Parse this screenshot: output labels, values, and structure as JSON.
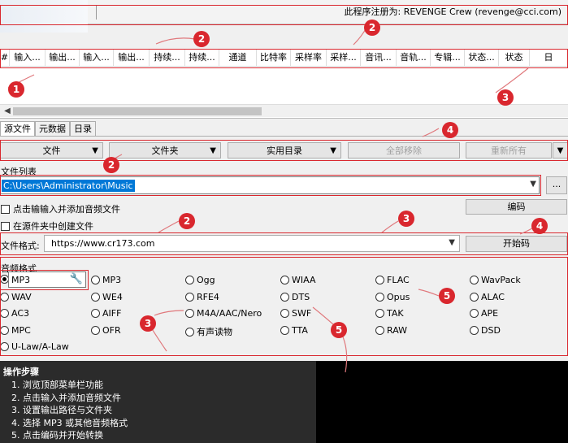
{
  "header": {
    "registered_to": "此程序注册为: REVENGE Crew (revenge@cci.com)"
  },
  "table": {
    "columns": [
      "#",
      "输入...",
      "输出...",
      "输入...",
      "输出...",
      "持续...",
      "持续...",
      "通道",
      "比特率",
      "采样率",
      "采样...",
      "音讯...",
      "音轨...",
      "专辑...",
      "状态...",
      "状态",
      "日"
    ]
  },
  "tabs": [
    "源文件",
    "元数据",
    "日录"
  ],
  "buttons": {
    "file": "文件",
    "folder": "文件夹",
    "utility": "实用目录",
    "remove_all": "全部移除",
    "reset_all": "重新所有",
    "browse": "...",
    "encode": "编码",
    "start": "开始码"
  },
  "file_list": {
    "label": "文件列表",
    "path": "C:\\Users\\Administrator\\Music"
  },
  "options": {
    "add_on_click": "点击输输入并添加音频文件",
    "create_in_source": "在源件夹中创建文件"
  },
  "format": {
    "label": "文件格式:",
    "url": "https://www.cr173.com"
  },
  "audio": {
    "label": "音频格式",
    "selected": "MP3",
    "wrench_icon": "wrench-icon",
    "col1": [
      "WAV",
      "AC3",
      "MPC",
      "U-Law/A-Law"
    ],
    "col2": [
      "MP3",
      "WE4",
      "AIFF",
      "OFR"
    ],
    "col3": [
      "Ogg",
      "RFE4",
      "M4A/AAC/Nero",
      "有声读物"
    ],
    "col4": [
      "WIAA",
      "DTS",
      "SWF",
      "TTA"
    ],
    "col5": [
      "FLAC",
      "Opus",
      "TAK",
      "RAW"
    ],
    "col6": [
      "WavPack",
      "ALAC",
      "APE",
      "DSD"
    ]
  },
  "instructions": {
    "title": "操作步骤",
    "steps": [
      "1. 浏览顶部菜单栏功能",
      "2. 点击输入并添加音频文件",
      "3. 设置输出路径与文件夹",
      "4. 选择 MP3 或其他音频格式",
      "5. 点击编码并开始转换"
    ]
  },
  "annotations": {
    "badges": [
      "1",
      "2",
      "2",
      "3",
      "4",
      "2",
      "2",
      "3",
      "4",
      "3",
      "5",
      "5"
    ],
    "color": "#d9272e"
  }
}
